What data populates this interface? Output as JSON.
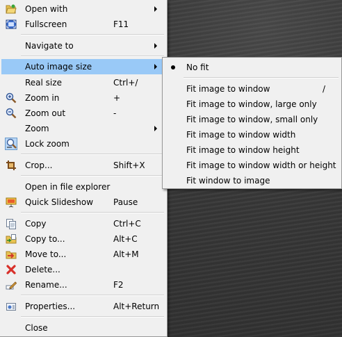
{
  "menu": {
    "open_with": "Open with",
    "fullscreen": "Fullscreen",
    "fullscreen_sc": "F11",
    "navigate_to": "Navigate to",
    "auto_image_size": "Auto image size",
    "real_size": "Real size",
    "real_size_sc": "Ctrl+/",
    "zoom_in": "Zoom in",
    "zoom_in_sc": "+",
    "zoom_out": "Zoom out",
    "zoom_out_sc": "-",
    "zoom": "Zoom",
    "lock_zoom": "Lock zoom",
    "crop": "Crop...",
    "crop_sc": "Shift+X",
    "open_in_explorer": "Open in file explorer",
    "quick_slideshow": "Quick Slideshow",
    "quick_slideshow_sc": "Pause",
    "copy": "Copy",
    "copy_sc": "Ctrl+C",
    "copy_to": "Copy to...",
    "copy_to_sc": "Alt+C",
    "move_to": "Move to...",
    "move_to_sc": "Alt+M",
    "delete": "Delete...",
    "rename": "Rename...",
    "rename_sc": "F2",
    "properties": "Properties...",
    "properties_sc": "Alt+Return",
    "close": "Close"
  },
  "submenu": {
    "no_fit": "No fit",
    "fit_window": "Fit image to window",
    "fit_window_sc": "/",
    "fit_window_large": "Fit image to window, large only",
    "fit_window_small": "Fit image to window, small only",
    "fit_width": "Fit image to window width",
    "fit_height": "Fit image to window height",
    "fit_width_or_height": "Fit image to window width or height",
    "fit_window_to_image": "Fit window to image"
  },
  "colors": {
    "highlight": "#99c9f7",
    "menu_bg": "#f0f0f0"
  },
  "icons": {
    "open_with": "folder-open-icon",
    "fullscreen": "fullscreen-icon",
    "zoom_in": "zoom-in-icon",
    "zoom_out": "zoom-out-icon",
    "lock_zoom": "lock-zoom-icon",
    "crop": "crop-icon",
    "quick_slideshow": "slideshow-icon",
    "copy": "copy-icon",
    "copy_to": "copy-to-icon",
    "move_to": "move-to-icon",
    "delete": "delete-icon",
    "rename": "rename-icon",
    "properties": "properties-icon"
  }
}
